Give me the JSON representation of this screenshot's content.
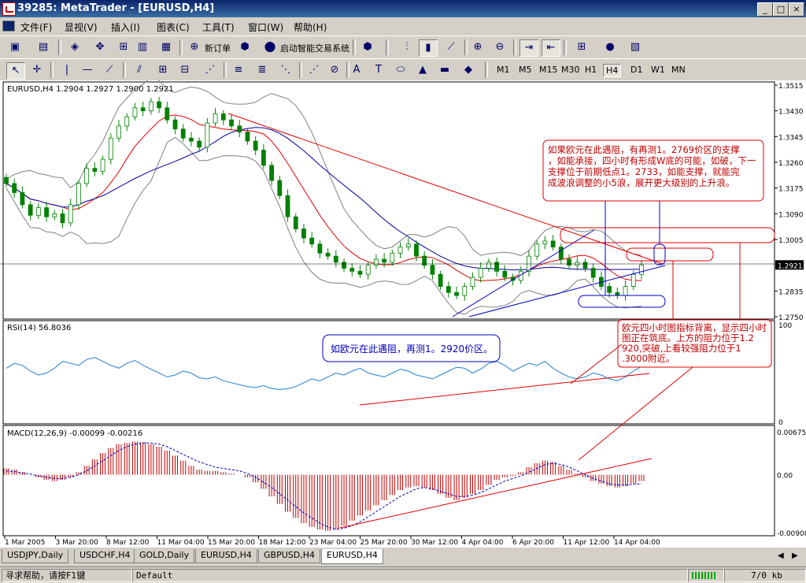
{
  "window": {
    "title": "39285: MetaTrader - [EURUSD,H4]"
  },
  "menu": [
    "文件(F)",
    "显视(V)",
    "插入(I)",
    "图表(C)",
    "工具(T)",
    "窗口(W)",
    "帮助(H)"
  ],
  "toolbar1": {
    "new_order": "新订单",
    "expert": "启动智能交易系统"
  },
  "toolbar2": {
    "text_tool": "A",
    "label_tool": "T",
    "timeframes": [
      "M1",
      "M5",
      "M15",
      "M30",
      "H1",
      "H4",
      "D1",
      "W1",
      "MN"
    ],
    "active_timeframe": "H4"
  },
  "chart_data": [
    {
      "type": "candlestick",
      "panel": "main",
      "header": "EURUSD,H4  1.2904 1.2927 1.2900 1.2921",
      "symbol": "EURUSD",
      "timeframe": "H4",
      "ohlc": {
        "open": 1.2904,
        "high": 1.2927,
        "low": 1.29,
        "close": 1.2921
      },
      "price_labels": [
        "1.3515",
        "1.3430",
        "1.3345",
        "1.3260",
        "1.3175",
        "1.3090",
        "1.3005",
        "1.2921",
        "1.2835",
        "1.2750"
      ],
      "ylim": [
        1.275,
        1.3515
      ],
      "current_price": "1.2921",
      "x_labels": [
        "1 Mar 2005",
        "3 Mar 20:00",
        "8 Mar 12:00",
        "11 Mar 04:00",
        "15 Mar 20:00",
        "18 Mar 12:00",
        "23 Mar 04:00",
        "25 Mar 20:00",
        "30 Mar 12:00",
        "4 Apr 04:00",
        "6 Apr 20:00",
        "11 Apr 12:00",
        "14 Apr 04:00"
      ],
      "close_series": [
        1.319,
        1.316,
        1.312,
        1.3085,
        1.311,
        1.308,
        1.309,
        1.306,
        1.312,
        1.319,
        1.324,
        1.323,
        1.327,
        1.334,
        1.338,
        1.341,
        1.344,
        1.343,
        1.346,
        1.344,
        1.34,
        1.337,
        1.334,
        1.333,
        1.331,
        1.339,
        1.342,
        1.34,
        1.338,
        1.336,
        1.333,
        1.33,
        1.325,
        1.32,
        1.315,
        1.308,
        1.304,
        1.301,
        1.299,
        1.296,
        1.295,
        1.293,
        1.291,
        1.29,
        1.289,
        1.292,
        1.294,
        1.293,
        1.296,
        1.298,
        1.299,
        1.295,
        1.292,
        1.289,
        1.285,
        1.283,
        1.282,
        1.285,
        1.288,
        1.291,
        1.293,
        1.29,
        1.288,
        1.287,
        1.29,
        1.295,
        1.299,
        1.3,
        1.298,
        1.294,
        1.292,
        1.293,
        1.291,
        1.288,
        1.285,
        1.283,
        1.282,
        1.285,
        1.289,
        1.2921
      ]
    },
    {
      "type": "line",
      "panel": "rsi",
      "header": "RSI(14) 56.8036",
      "ylim": [
        0,
        100
      ],
      "y_labels": [
        "100",
        "0"
      ],
      "values": [
        55,
        60,
        58,
        52,
        48,
        50,
        55,
        62,
        60,
        58,
        64,
        66,
        62,
        58,
        55,
        60,
        63,
        58,
        54,
        50,
        46,
        48,
        52,
        50,
        45,
        44,
        46,
        42,
        40,
        38,
        36,
        35,
        37,
        34,
        33,
        34,
        36,
        40,
        44,
        42,
        46,
        50,
        48,
        52,
        55,
        50,
        48,
        46,
        50,
        54,
        52,
        48,
        46,
        44,
        48,
        52,
        56,
        55,
        50,
        54,
        60,
        62,
        58,
        52,
        56,
        60,
        58,
        62,
        55,
        50,
        46,
        44,
        46,
        50,
        48,
        44,
        42,
        46,
        52,
        56.8
      ]
    },
    {
      "type": "bar",
      "panel": "macd",
      "header": "MACD(12,26,9) -0.00099 -0.00216",
      "ylim": [
        -0.00908,
        0.00675
      ],
      "y_labels": [
        "0.00675",
        "0.00",
        "-0.00908"
      ],
      "histogram": [
        0.001,
        0.0008,
        0.0004,
        0.0,
        -0.0004,
        -0.0008,
        -0.001,
        -0.0008,
        -0.0004,
        0.0004,
        0.0014,
        0.0024,
        0.0034,
        0.0042,
        0.0048,
        0.005,
        0.0052,
        0.0051,
        0.0048,
        0.0044,
        0.0038,
        0.003,
        0.0022,
        0.0014,
        0.0008,
        0.0006,
        0.0006,
        0.0004,
        0.0002,
        0.0,
        -0.0004,
        -0.0012,
        -0.0022,
        -0.0034,
        -0.0046,
        -0.0058,
        -0.0068,
        -0.0076,
        -0.0082,
        -0.0086,
        -0.0088,
        -0.0086,
        -0.008,
        -0.0072,
        -0.0064,
        -0.0056,
        -0.0048,
        -0.004,
        -0.0032,
        -0.0024,
        -0.002,
        -0.0018,
        -0.002,
        -0.0024,
        -0.003,
        -0.0036,
        -0.004,
        -0.0036,
        -0.003,
        -0.0024,
        -0.0016,
        -0.0008,
        -0.0004,
        -0.0002,
        0.0004,
        0.0012,
        0.0018,
        0.0022,
        0.002,
        0.0014,
        0.0008,
        0.0002,
        -0.0004,
        -0.001,
        -0.0014,
        -0.0018,
        -0.002,
        -0.0018,
        -0.0014,
        -0.001
      ],
      "signal": [
        0.0006,
        0.0005,
        0.0003,
        0.0001,
        -0.0002,
        -0.0004,
        -0.0006,
        -0.0006,
        -0.0004,
        0.0,
        0.0006,
        0.0014,
        0.0022,
        0.003,
        0.0038,
        0.0044,
        0.0048,
        0.005,
        0.005,
        0.0048,
        0.0044,
        0.0038,
        0.0032,
        0.0026,
        0.002,
        0.0016,
        0.0012,
        0.001,
        0.0008,
        0.0006,
        0.0002,
        -0.0004,
        -0.0012,
        -0.002,
        -0.003,
        -0.004,
        -0.005,
        -0.006,
        -0.0068,
        -0.0076,
        -0.0082,
        -0.0086,
        -0.0084,
        -0.008,
        -0.0074,
        -0.0066,
        -0.0058,
        -0.005,
        -0.0042,
        -0.0034,
        -0.0028,
        -0.0022,
        -0.002,
        -0.0022,
        -0.0026,
        -0.003,
        -0.0034,
        -0.0034,
        -0.0032,
        -0.0028,
        -0.0022,
        -0.0016,
        -0.001,
        -0.0006,
        -0.0002,
        0.0004,
        0.001,
        0.0016,
        0.0018,
        0.0016,
        0.0012,
        0.0006,
        0.0,
        -0.0006,
        -0.001,
        -0.0014,
        -0.0016,
        -0.0016,
        -0.0015,
        -0.0014
      ]
    }
  ],
  "annotations": {
    "top_right": "如果欧元在此遇阻，有再测1。2769价区的支撑，如能承接，四小时有形成W底的可能，如破，下一支撑位于前期低点1。2733，如能支撑，就能完成波浪调整的小5浪，展开更大级别的上升浪。",
    "blue_box": "如欧元在此遇阻，再测1。2920价区。",
    "red_box": "欧元四小时图指标背离，显示四小时图正在筑底。上方的阻力位于1.2920,突破,上看较强阻力位于1.3000附近。"
  },
  "tabs": [
    "USDJPY,Daily",
    "USDCHF,H4",
    "GOLD,Daily",
    "EURUSD,H4",
    "GBPUSD,H4",
    "EURUSD,H4"
  ],
  "status": {
    "help": "寻求帮助，请按F1键",
    "profile": "Default",
    "traffic": "7/0 kb"
  },
  "colors": {
    "bull": "#008000",
    "bear": "#008000",
    "ma_fast": "#e00000",
    "ma_slow": "#0000a0",
    "bands": "#808080",
    "rsi": "#1e7fd0",
    "macd_hist": "#c00000",
    "trend_red": "#e00000",
    "trend_blue": "#0000c0"
  }
}
